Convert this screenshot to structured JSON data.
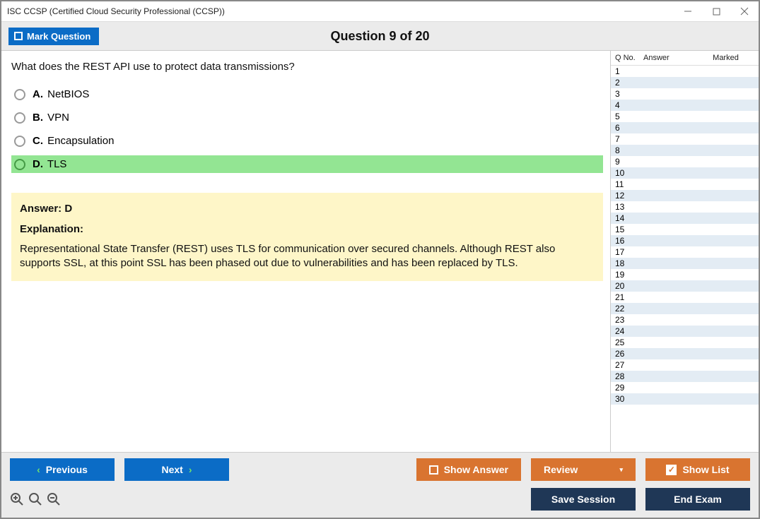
{
  "window": {
    "title": "ISC CCSP (Certified Cloud Security Professional (CCSP))"
  },
  "topbar": {
    "mark_label": "Mark Question",
    "counter": "Question 9 of 20"
  },
  "question": {
    "text": "What does the REST API use to protect data transmissions?",
    "options": [
      {
        "letter": "A.",
        "text": "NetBIOS",
        "selected": false
      },
      {
        "letter": "B.",
        "text": "VPN",
        "selected": false
      },
      {
        "letter": "C.",
        "text": "Encapsulation",
        "selected": false
      },
      {
        "letter": "D.",
        "text": "TLS",
        "selected": true
      }
    ]
  },
  "answer": {
    "line": "Answer: D",
    "explanation_label": "Explanation:",
    "explanation_text": "Representational State Transfer (REST) uses TLS for communication over secured channels. Although REST also supports SSL, at this point SSL has been phased out due to vulnerabilities and has been replaced by TLS."
  },
  "side": {
    "headers": {
      "qno": "Q No.",
      "answer": "Answer",
      "marked": "Marked"
    },
    "rows": [
      1,
      2,
      3,
      4,
      5,
      6,
      7,
      8,
      9,
      10,
      11,
      12,
      13,
      14,
      15,
      16,
      17,
      18,
      19,
      20,
      21,
      22,
      23,
      24,
      25,
      26,
      27,
      28,
      29,
      30
    ]
  },
  "bottom": {
    "previous": "Previous",
    "next": "Next",
    "show_answer": "Show Answer",
    "review": "Review",
    "show_list": "Show List",
    "save_session": "Save Session",
    "end_exam": "End Exam"
  }
}
